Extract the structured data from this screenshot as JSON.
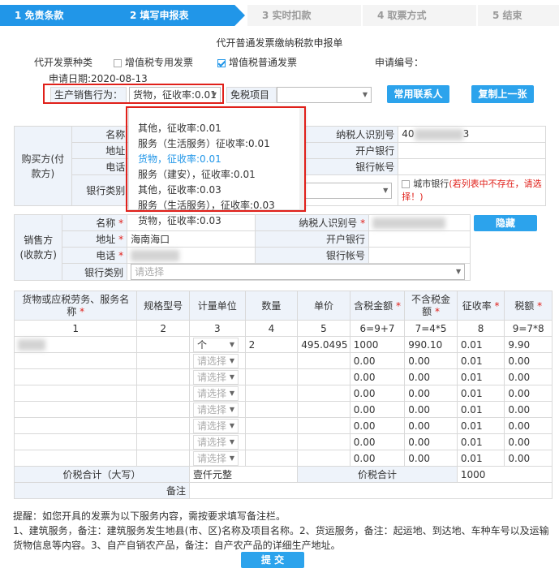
{
  "steps": [
    {
      "label": "1  免责条款",
      "state": "active"
    },
    {
      "label": "2  填写申报表",
      "state": "active"
    },
    {
      "label": "3  实时扣款",
      "state": "inactive"
    },
    {
      "label": "4  取票方式",
      "state": "inactive"
    },
    {
      "label": "5  结束",
      "state": "inactive"
    }
  ],
  "title": "代开普通发票缴纳税款申报单",
  "invoice_type_label": "代开发票种类",
  "invoice_opt1": "增值税专用发票",
  "invoice_opt2": "增值税普通发票",
  "app_no_label": "申请编号：",
  "app_date": "申请日期:2020-08-13",
  "prod_label": "生产销售行为：",
  "prod_value": "货物，征收率:0.01",
  "exempt_label": "免税项目",
  "btn_contacts": "常用联系人",
  "btn_copy": "复制上一张",
  "btn_hide": "隐藏",
  "dropdown": [
    "其他，征收率:0.01",
    "服务（生活服务）征收率:0.01",
    "货物，征收率:0.01",
    "服务（建安），征收率:0.01",
    "其他，征收率:0.03",
    "服务（生活服务），征收率:0.03",
    "货物，征收率:0.03"
  ],
  "buyer": {
    "section": "购买方(付款方)",
    "name": "名称",
    "addr": "地址",
    "phone": "电话",
    "bank_type": "银行类别",
    "taxid": "纳税人识别号",
    "taxid_prefix": "40",
    "taxid_suffix": "3",
    "bank": "开户银行",
    "account": "银行帐号",
    "city_bank": "城市银行",
    "city_bank_note": "(若列表中不存在，请选择！)"
  },
  "seller": {
    "section": "销售方(收款方)",
    "name": "名称",
    "addr": "地址",
    "addr_val": "海南海口",
    "phone": "电话",
    "bank_type": "银行类别",
    "bank_type_ph": "请选择",
    "taxid": "纳税人识别号",
    "bank": "开户银行",
    "account": "银行帐号"
  },
  "goods_header": [
    "货物或应税劳务、服务名称",
    "规格型号",
    "计量单位",
    "数量",
    "单价",
    "含税金额",
    "不含税金额",
    "征收率",
    "税额"
  ],
  "goods_index": [
    "1",
    "2",
    "3",
    "4",
    "5",
    "6=9+7",
    "7=4*5",
    "8",
    "9=7*8"
  ],
  "rows": [
    {
      "unit": "个",
      "qty": "2",
      "price": "495.0495",
      "amt": "1000",
      "net": "990.10",
      "rate": "0.01",
      "tax": "9.90"
    },
    {
      "unit": "请选择",
      "qty": "",
      "price": "",
      "amt": "0.00",
      "net": "0.00",
      "rate": "0.01",
      "tax": "0.00"
    },
    {
      "unit": "请选择",
      "qty": "",
      "price": "",
      "amt": "0.00",
      "net": "0.00",
      "rate": "0.01",
      "tax": "0.00"
    },
    {
      "unit": "请选择",
      "qty": "",
      "price": "",
      "amt": "0.00",
      "net": "0.00",
      "rate": "0.01",
      "tax": "0.00"
    },
    {
      "unit": "请选择",
      "qty": "",
      "price": "",
      "amt": "0.00",
      "net": "0.00",
      "rate": "0.01",
      "tax": "0.00"
    },
    {
      "unit": "请选择",
      "qty": "",
      "price": "",
      "amt": "0.00",
      "net": "0.00",
      "rate": "0.01",
      "tax": "0.00"
    },
    {
      "unit": "请选择",
      "qty": "",
      "price": "",
      "amt": "0.00",
      "net": "0.00",
      "rate": "0.01",
      "tax": "0.00"
    },
    {
      "unit": "请选择",
      "qty": "",
      "price": "",
      "amt": "0.00",
      "net": "0.00",
      "rate": "0.01",
      "tax": "0.00"
    }
  ],
  "total_cap_label": "价税合计（大写）",
  "total_cap_value": "壹仟元整",
  "total_label": "价税合计",
  "total_value": "1000",
  "remark_label": "备注",
  "notes": [
    "提醒：如您开具的发票为以下服务内容，需按要求填写备注栏。",
    "1、建筑服务，备注：建筑服务发生地县(市、区)名称及项目名称。2、货运服务，备注：起运地、到达地、车种车号以及运输货物信息等内容。3、自产自销农产品，备注：自产农产品的详细生产地址。"
  ],
  "submit": "提 交"
}
